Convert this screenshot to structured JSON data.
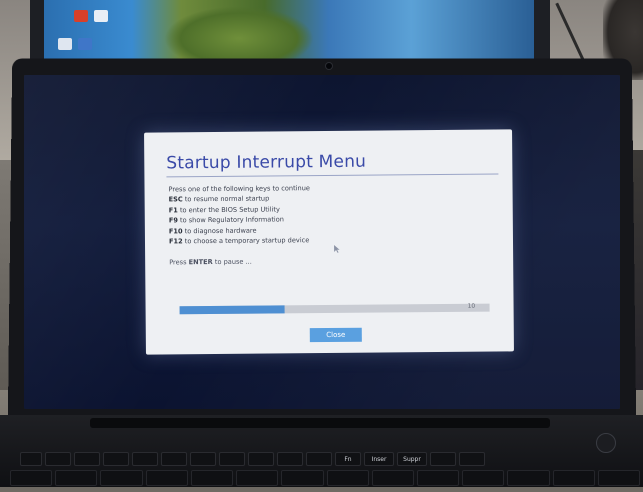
{
  "dialog": {
    "title": "Startup Interrupt Menu",
    "intro": "Press one of the following keys to continue",
    "options": [
      {
        "key": "ESC",
        "text": "to resume normal startup"
      },
      {
        "key": "F1",
        "text": "to enter the BIOS Setup Utility"
      },
      {
        "key": "F9",
        "text": "to show Regulatory Information"
      },
      {
        "key": "F10",
        "text": "to diagnose hardware"
      },
      {
        "key": "F12",
        "text": "to choose a temporary startup device"
      }
    ],
    "pause": {
      "prefix": "Press",
      "key": "ENTER",
      "suffix": "to pause ..."
    },
    "countdown": "10",
    "progress_fraction": 0.34,
    "close_label": "Close"
  },
  "keyboard": {
    "keys": [
      "",
      "",
      "",
      "",
      "",
      "",
      "",
      "",
      "",
      "",
      "",
      "Fn",
      "Inser",
      "Suppr",
      "",
      ""
    ]
  },
  "colors": {
    "title": "#3a4aa8",
    "progress": "#4e8fd2",
    "button": "#5aa0e0",
    "screen": "#101a3a"
  }
}
